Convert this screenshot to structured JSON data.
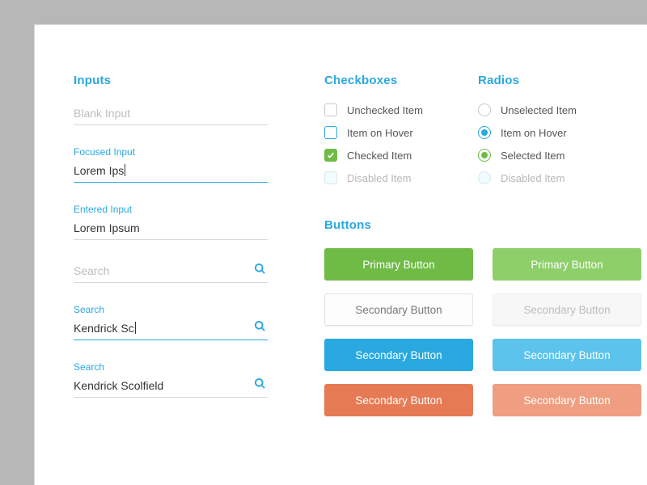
{
  "sections": {
    "inputs": "Inputs",
    "checkboxes": "Checkboxes",
    "radios": "Radios",
    "buttons": "Buttons"
  },
  "inputs": {
    "blank_placeholder": "Blank Input",
    "focused_label": "Focused Input",
    "focused_value": "Lorem Ips",
    "entered_label": "Entered Input",
    "entered_value": "Lorem Ipsum",
    "search_placeholder": "Search",
    "search_label": "Search",
    "search_focused_value": "Kendrick Sc",
    "search_filled_value": "Kendrick Scolfield"
  },
  "checkboxes": [
    {
      "label": "Unchecked Item",
      "state": "unchecked"
    },
    {
      "label": "Item on Hover",
      "state": "hover"
    },
    {
      "label": "Checked Item",
      "state": "checked"
    },
    {
      "label": "Disabled Item",
      "state": "disabled"
    }
  ],
  "radios": [
    {
      "label": "Unselected Item",
      "state": "unselected"
    },
    {
      "label": "Item on Hover",
      "state": "hover"
    },
    {
      "label": "Selected Item",
      "state": "selected"
    },
    {
      "label": "Disabled Item",
      "state": "disabled"
    }
  ],
  "buttons": {
    "primary": "Primary Button",
    "secondary": "Secondary Button"
  }
}
